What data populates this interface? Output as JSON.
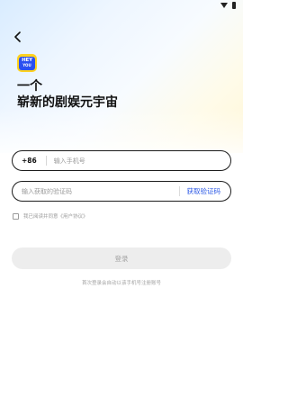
{
  "headline": {
    "line1": "一个",
    "line2": "崭新的剧娱元宇宙"
  },
  "logo": {
    "top": "HEY",
    "bottom": "YOU"
  },
  "phone": {
    "country_code": "+86",
    "placeholder": "输入手机号"
  },
  "code": {
    "placeholder": "输入获取的验证码",
    "get_code_label": "获取验证码"
  },
  "agreement": {
    "label": "我已阅读并同意《用户协议》",
    "checked": false
  },
  "login": {
    "label": "登录"
  },
  "hint": "首次登录会自动以该手机号注册账号",
  "colors": {
    "accent": "#2f5be6",
    "logo_yellow": "#ffd21e",
    "logo_blue": "#2a4ff0"
  }
}
